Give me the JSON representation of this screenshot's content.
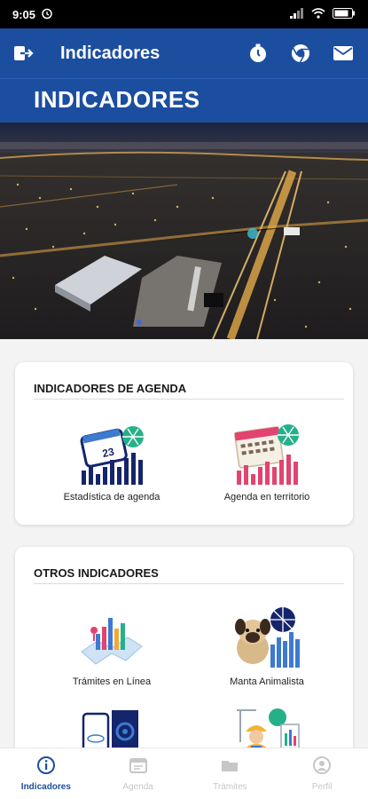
{
  "status": {
    "time": "9:05"
  },
  "appbar": {
    "title": "Indicadores"
  },
  "header": {
    "title": "INDICADORES"
  },
  "agenda": {
    "title": "INDICADORES DE AGENDA",
    "items": [
      {
        "label": "Estadística de agenda",
        "icon": "calendar-stats-icon"
      },
      {
        "label": "Agenda en territorio",
        "icon": "calendar-territory-icon"
      }
    ]
  },
  "otros": {
    "title": "OTROS INDICADORES",
    "items": [
      {
        "label": "Trámites en Línea",
        "icon": "online-procedures-icon"
      },
      {
        "label": "Manta Animalista",
        "icon": "dog-stats-icon"
      },
      {
        "label": "",
        "icon": "phone-document-icon"
      },
      {
        "label": "",
        "icon": "worker-stats-icon"
      }
    ]
  },
  "nav": [
    {
      "label": "Indicadores",
      "active": true
    },
    {
      "label": "Agenda",
      "active": false
    },
    {
      "label": "Trámites",
      "active": false
    },
    {
      "label": "Perfil",
      "active": false
    }
  ],
  "colors": {
    "primary": "#1c4ea0",
    "accent_teal": "#26b08a",
    "navy": "#15256b"
  }
}
